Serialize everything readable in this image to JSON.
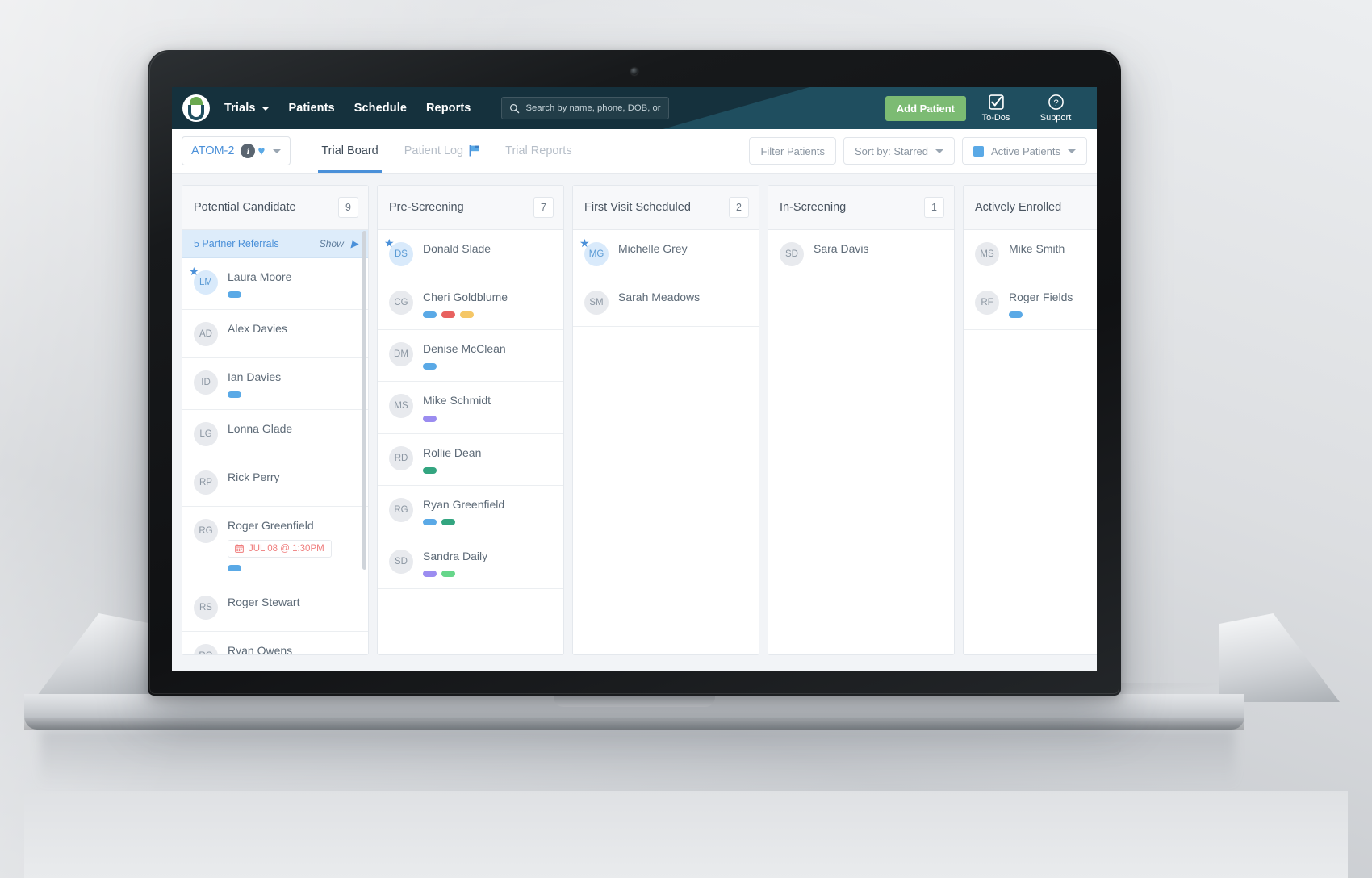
{
  "app": {
    "brand_logo": "sprout-logo",
    "navbar_bg": "#1f4e5f",
    "accent_blue": "#4a90d9",
    "accent_green": "#7cbb73"
  },
  "navbar": {
    "links": [
      {
        "label": "Trials",
        "has_caret": true
      },
      {
        "label": "Patients",
        "has_caret": false
      },
      {
        "label": "Schedule",
        "has_caret": false
      },
      {
        "label": "Reports",
        "has_caret": false
      }
    ],
    "search": {
      "placeholder": "Search by name, phone, DOB, or MRN",
      "value": "",
      "icon": "search-icon"
    },
    "add_patient_label": "Add Patient",
    "todos_label": "To-Dos",
    "support_label": "Support"
  },
  "subheader": {
    "trial_name": "ATOM-2",
    "trial_icons": [
      "info-icon",
      "heart-icon",
      "chevron-down-icon"
    ],
    "tabs": [
      {
        "label": "Trial Board",
        "active": true,
        "icon": null
      },
      {
        "label": "Patient Log",
        "active": false,
        "icon": "flag-icon"
      },
      {
        "label": "Trial Reports",
        "active": false,
        "icon": null
      }
    ],
    "filter_label": "Filter Patients",
    "sort_label": "Sort by: Starred",
    "view_label": "Active Patients",
    "view_swatch": "#5aa9e6"
  },
  "board": {
    "columns": [
      {
        "title": "Potential Candidate",
        "count": "9",
        "referral_banner": {
          "text": "5 Partner Referrals",
          "action": "Show"
        },
        "scrollbar": true,
        "cards": [
          {
            "initials": "LM",
            "name": "Laura Moore",
            "starred": true,
            "tags": [
              "#5aa9e6"
            ],
            "appointment": null
          },
          {
            "initials": "AD",
            "name": "Alex Davies",
            "starred": false,
            "tags": [],
            "appointment": null
          },
          {
            "initials": "ID",
            "name": "Ian Davies",
            "starred": false,
            "tags": [
              "#5aa9e6"
            ],
            "appointment": null
          },
          {
            "initials": "LG",
            "name": "Lonna Glade",
            "starred": false,
            "tags": [],
            "appointment": null
          },
          {
            "initials": "RP",
            "name": "Rick Perry",
            "starred": false,
            "tags": [],
            "appointment": null
          },
          {
            "initials": "RG",
            "name": "Roger Greenfield",
            "starred": false,
            "tags": [
              "#5aa9e6"
            ],
            "appointment": "JUL 08 @ 1:30PM"
          },
          {
            "initials": "RS",
            "name": "Roger Stewart",
            "starred": false,
            "tags": [],
            "appointment": null
          },
          {
            "initials": "RO",
            "name": "Ryan Owens",
            "starred": false,
            "tags": [],
            "appointment": null
          }
        ]
      },
      {
        "title": "Pre-Screening",
        "count": "7",
        "referral_banner": null,
        "scrollbar": false,
        "cards": [
          {
            "initials": "DS",
            "name": "Donald Slade",
            "starred": true,
            "tags": [],
            "appointment": null
          },
          {
            "initials": "CG",
            "name": "Cheri Goldblume",
            "starred": false,
            "tags": [
              "#5aa9e6",
              "#e8615f",
              "#f5c767"
            ],
            "appointment": null
          },
          {
            "initials": "DM",
            "name": "Denise McClean",
            "starred": false,
            "tags": [
              "#5aa9e6"
            ],
            "appointment": null
          },
          {
            "initials": "MS",
            "name": "Mike Schmidt",
            "starred": false,
            "tags": [
              "#9b8cf0"
            ],
            "appointment": null
          },
          {
            "initials": "RD",
            "name": "Rollie Dean",
            "starred": false,
            "tags": [
              "#33a580"
            ],
            "appointment": null
          },
          {
            "initials": "RG",
            "name": "Ryan Greenfield",
            "starred": false,
            "tags": [
              "#5aa9e6",
              "#33a580"
            ],
            "appointment": null
          },
          {
            "initials": "SD",
            "name": "Sandra Daily",
            "starred": false,
            "tags": [
              "#9b8cf0",
              "#66d68a"
            ],
            "appointment": null
          }
        ]
      },
      {
        "title": "First Visit Scheduled",
        "count": "2",
        "referral_banner": null,
        "scrollbar": false,
        "cards": [
          {
            "initials": "MG",
            "name": "Michelle Grey",
            "starred": true,
            "tags": [],
            "appointment": null
          },
          {
            "initials": "SM",
            "name": "Sarah Meadows",
            "starred": false,
            "tags": [],
            "appointment": null
          }
        ]
      },
      {
        "title": "In-Screening",
        "count": "1",
        "referral_banner": null,
        "scrollbar": false,
        "cards": [
          {
            "initials": "SD",
            "name": "Sara Davis",
            "starred": false,
            "tags": [],
            "appointment": null
          }
        ]
      },
      {
        "title": "Actively Enrolled",
        "count": "",
        "referral_banner": null,
        "scrollbar": false,
        "cards": [
          {
            "initials": "MS",
            "name": "Mike Smith",
            "starred": false,
            "tags": [],
            "appointment": null
          },
          {
            "initials": "RF",
            "name": "Roger Fields",
            "starred": false,
            "tags": [
              "#5aa9e6"
            ],
            "appointment": null
          }
        ]
      }
    ]
  }
}
